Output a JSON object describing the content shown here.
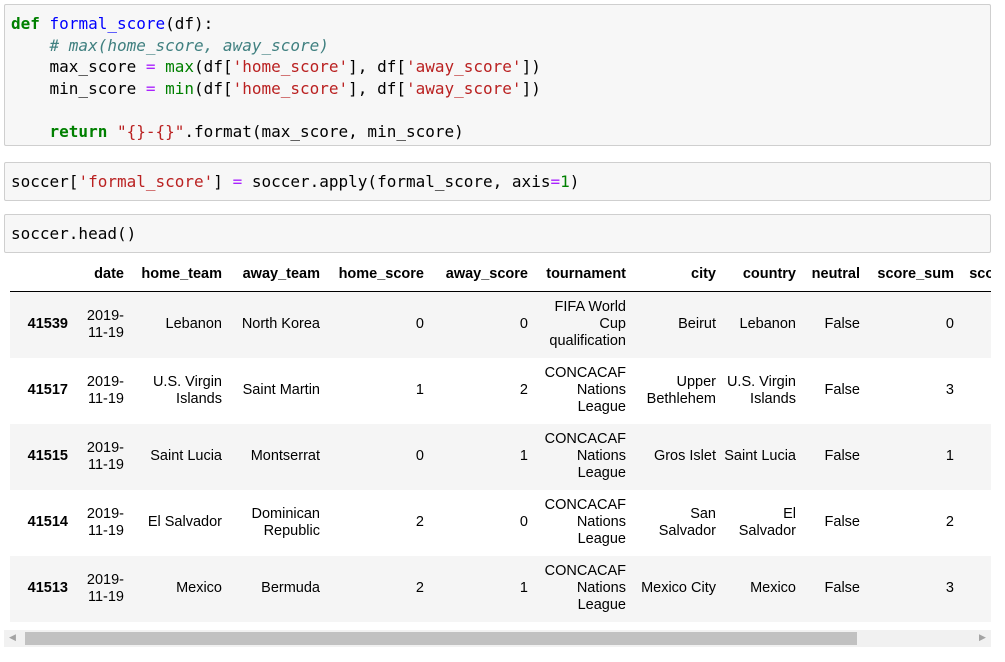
{
  "cells": {
    "def_cell": {
      "lines": [
        [
          {
            "t": "def",
            "c": "kw"
          },
          {
            "t": " "
          },
          {
            "t": "formal_score",
            "c": "fn"
          },
          {
            "t": "(df):"
          }
        ],
        [
          {
            "t": "    "
          },
          {
            "t": "# max(home_score, away_score)",
            "c": "cm"
          }
        ],
        [
          {
            "t": "    max_score "
          },
          {
            "t": "=",
            "c": "op"
          },
          {
            "t": " "
          },
          {
            "t": "max",
            "c": "bi"
          },
          {
            "t": "(df["
          },
          {
            "t": "'home_score'",
            "c": "str"
          },
          {
            "t": "], df["
          },
          {
            "t": "'away_score'",
            "c": "str"
          },
          {
            "t": "])"
          }
        ],
        [
          {
            "t": "    min_score "
          },
          {
            "t": "=",
            "c": "op"
          },
          {
            "t": " "
          },
          {
            "t": "min",
            "c": "bi"
          },
          {
            "t": "(df["
          },
          {
            "t": "'home_score'",
            "c": "str"
          },
          {
            "t": "], df["
          },
          {
            "t": "'away_score'",
            "c": "str"
          },
          {
            "t": "])"
          }
        ],
        [
          {
            "t": " "
          }
        ],
        [
          {
            "t": "    "
          },
          {
            "t": "return",
            "c": "kw"
          },
          {
            "t": " "
          },
          {
            "t": "\"{}-{}\"",
            "c": "str"
          },
          {
            "t": ".format(max_score, min_score)"
          }
        ]
      ]
    },
    "apply_cell": {
      "lines": [
        [
          {
            "t": "soccer["
          },
          {
            "t": "'formal_score'",
            "c": "str"
          },
          {
            "t": "] "
          },
          {
            "t": "=",
            "c": "op"
          },
          {
            "t": " soccer.apply(formal_score, axis"
          },
          {
            "t": "=",
            "c": "op"
          },
          {
            "t": "1",
            "c": "num"
          },
          {
            "t": ")"
          }
        ]
      ]
    },
    "head_cell": {
      "lines": [
        [
          {
            "t": "soccer.head()"
          }
        ]
      ]
    }
  },
  "table": {
    "columns": [
      "",
      "date",
      "home_team",
      "away_team",
      "home_score",
      "away_score",
      "tournament",
      "city",
      "country",
      "neutral",
      "score_sum",
      "score_"
    ],
    "rows": [
      {
        "index": "41539",
        "cells": [
          "2019-11-19",
          "Lebanon",
          "North Korea",
          "0",
          "0",
          "FIFA World Cup qualification",
          "Beirut",
          "Lebanon",
          "False",
          "0",
          ""
        ]
      },
      {
        "index": "41517",
        "cells": [
          "2019-11-19",
          "U.S. Virgin Islands",
          "Saint Martin",
          "1",
          "2",
          "CONCACAF Nations League",
          "Upper Bethlehem",
          "U.S. Virgin Islands",
          "False",
          "3",
          ""
        ]
      },
      {
        "index": "41515",
        "cells": [
          "2019-11-19",
          "Saint Lucia",
          "Montserrat",
          "0",
          "1",
          "CONCACAF Nations League",
          "Gros Islet",
          "Saint Lucia",
          "False",
          "1",
          ""
        ]
      },
      {
        "index": "41514",
        "cells": [
          "2019-11-19",
          "El Salvador",
          "Dominican Republic",
          "2",
          "0",
          "CONCACAF Nations League",
          "San Salvador",
          "El Salvador",
          "False",
          "2",
          ""
        ]
      },
      {
        "index": "41513",
        "cells": [
          "2019-11-19",
          "Mexico",
          "Bermuda",
          "2",
          "1",
          "CONCACAF Nations League",
          "Mexico City",
          "Mexico",
          "False",
          "3",
          ""
        ]
      }
    ]
  },
  "scrollbar": {
    "left_arrow": "◀",
    "right_arrow": "▶"
  }
}
